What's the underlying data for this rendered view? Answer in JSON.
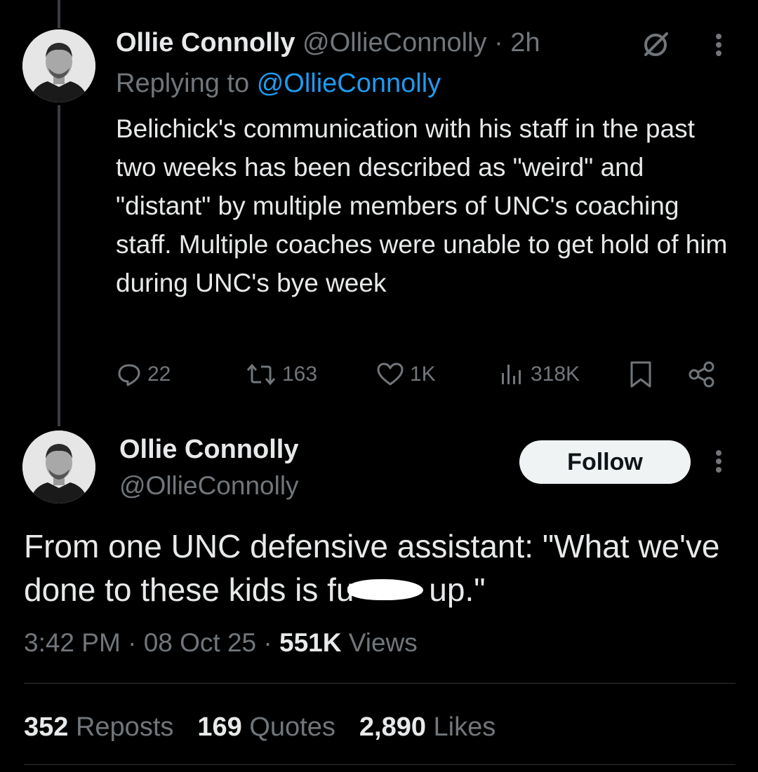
{
  "reply_tweet": {
    "author_name": "Ollie Connolly",
    "author_handle": "@OllieConnolly",
    "separator": "·",
    "time_ago": "2h",
    "replying_to_label": "Replying to",
    "replying_to_handle": "@OllieConnolly",
    "text": "Belichick's communication with his staff in the past two weeks has been described as \"weird\" and \"distant\" by multiple members of UNC's coaching staff. Multiple coaches were unable to get hold of him during UNC's bye week",
    "actions": {
      "replies": "22",
      "reposts": "163",
      "likes": "1K",
      "views": "318K"
    }
  },
  "main_tweet": {
    "author_name": "Ollie Connolly",
    "author_handle": "@OllieConnolly",
    "follow_label": "Follow",
    "text_part1": "From one UNC defensive assistant: \"What we've done to these kids is fu",
    "text_part2": " up.\"",
    "time": "3:42 PM",
    "date": "08 Oct 25",
    "views_count": "551K",
    "views_label": "Views",
    "meta_separator": "·",
    "stats": {
      "reposts_count": "352",
      "reposts_label": "Reposts",
      "quotes_count": "169",
      "quotes_label": "Quotes",
      "likes_count": "2,890",
      "likes_label": "Likes"
    }
  },
  "icons": [
    "grok-icon",
    "more-icon",
    "reply-icon",
    "repost-icon",
    "like-icon",
    "views-icon",
    "bookmark-icon",
    "share-icon"
  ],
  "colors": {
    "background": "#000000",
    "text": "#e7e9ea",
    "muted": "#71767b",
    "link": "#1d9bf0",
    "divider": "#2f3336",
    "follow_button_bg": "#eff3f4"
  }
}
